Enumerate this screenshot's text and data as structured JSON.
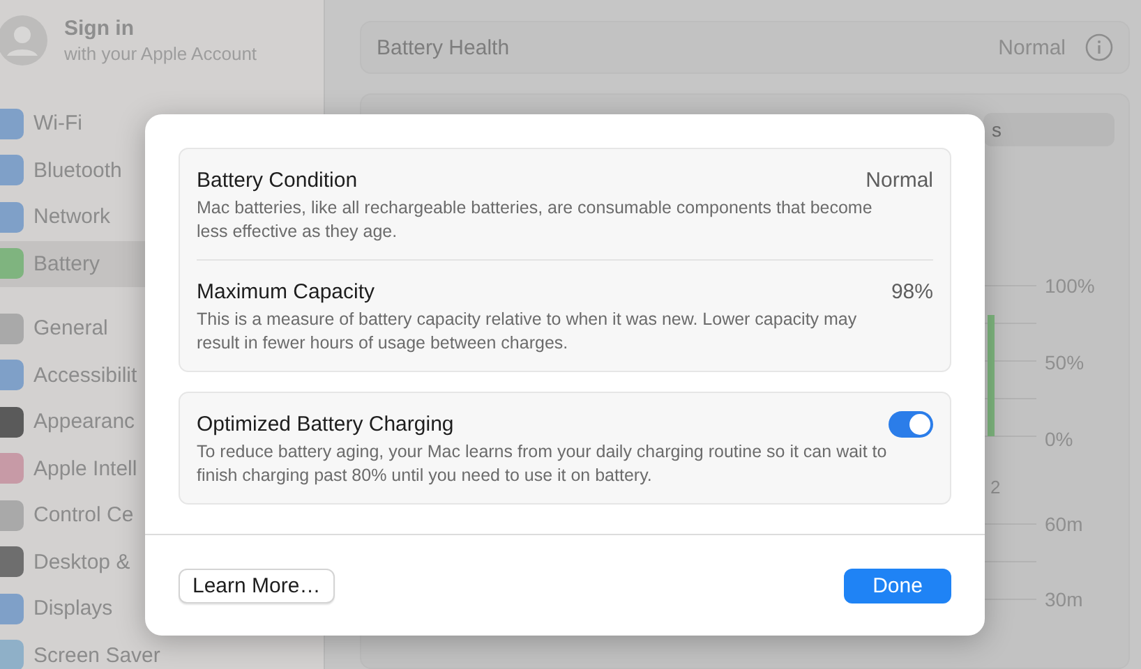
{
  "sidebar": {
    "account": {
      "title": "Sign in",
      "subtitle": "with your Apple Account"
    },
    "items": [
      {
        "label": "Wi-Fi",
        "color": "#7fa0c8",
        "selected": false
      },
      {
        "label": "Bluetooth",
        "color": "#7fa0c8",
        "selected": false
      },
      {
        "label": "Network",
        "color": "#7fa0c8",
        "selected": false
      },
      {
        "label": "Battery",
        "color": "#7fb47f",
        "selected": true
      },
      {
        "label": "General",
        "color": "#a9a9a9",
        "selected": false,
        "gap": true
      },
      {
        "label": "Accessibilit",
        "color": "#7fa0c8",
        "selected": false
      },
      {
        "label": "Appearanc",
        "color": "#5a5a5a",
        "selected": false
      },
      {
        "label": "Apple Intell",
        "color": "#c79aa6",
        "selected": false
      },
      {
        "label": "Control Ce",
        "color": "#a9a9a9",
        "selected": false
      },
      {
        "label": "Desktop &",
        "color": "#6e6e6e",
        "selected": false
      },
      {
        "label": "Displays",
        "color": "#7fa0c8",
        "selected": false
      },
      {
        "label": "Screen Saver",
        "color": "#8fb0c8",
        "selected": false
      }
    ]
  },
  "main": {
    "health": {
      "label": "Battery Health",
      "value": "Normal"
    },
    "segment": {
      "label": "s"
    },
    "level_axis": [
      "100%",
      "50%",
      "0%"
    ],
    "x_label": "2",
    "usage_axis": [
      "60m",
      "30m"
    ]
  },
  "dialog": {
    "groups": [
      [
        {
          "title": "Battery Condition",
          "value": "Normal",
          "description": "Mac batteries, like all rechargeable batteries, are consumable components that become less effective as they age.",
          "kind": "value"
        },
        {
          "title": "Maximum Capacity",
          "value": "98%",
          "description": "This is a measure of battery capacity relative to when it was new. Lower capacity may result in fewer hours of usage between charges.",
          "kind": "value"
        }
      ],
      [
        {
          "title": "Optimized Battery Charging",
          "on": true,
          "description": "To reduce battery aging, your Mac learns from your daily charging routine so it can wait to finish charging past 80% until you need to use it on battery.",
          "kind": "toggle"
        }
      ]
    ],
    "buttons": [
      {
        "label": "Learn More…",
        "kind": "secondary"
      },
      {
        "label": "Done",
        "kind": "primary"
      }
    ]
  }
}
